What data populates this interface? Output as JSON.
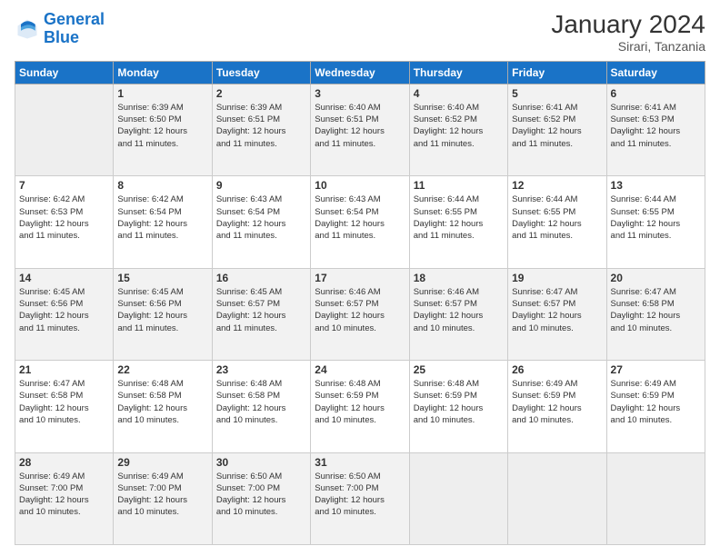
{
  "logo": {
    "line1": "General",
    "line2": "Blue"
  },
  "title": "January 2024",
  "location": "Sirari, Tanzania",
  "days_header": [
    "Sunday",
    "Monday",
    "Tuesday",
    "Wednesday",
    "Thursday",
    "Friday",
    "Saturday"
  ],
  "weeks": [
    [
      {
        "day": "",
        "info": ""
      },
      {
        "day": "1",
        "info": "Sunrise: 6:39 AM\nSunset: 6:50 PM\nDaylight: 12 hours\nand 11 minutes."
      },
      {
        "day": "2",
        "info": "Sunrise: 6:39 AM\nSunset: 6:51 PM\nDaylight: 12 hours\nand 11 minutes."
      },
      {
        "day": "3",
        "info": "Sunrise: 6:40 AM\nSunset: 6:51 PM\nDaylight: 12 hours\nand 11 minutes."
      },
      {
        "day": "4",
        "info": "Sunrise: 6:40 AM\nSunset: 6:52 PM\nDaylight: 12 hours\nand 11 minutes."
      },
      {
        "day": "5",
        "info": "Sunrise: 6:41 AM\nSunset: 6:52 PM\nDaylight: 12 hours\nand 11 minutes."
      },
      {
        "day": "6",
        "info": "Sunrise: 6:41 AM\nSunset: 6:53 PM\nDaylight: 12 hours\nand 11 minutes."
      }
    ],
    [
      {
        "day": "7",
        "info": "Sunrise: 6:42 AM\nSunset: 6:53 PM\nDaylight: 12 hours\nand 11 minutes."
      },
      {
        "day": "8",
        "info": "Sunrise: 6:42 AM\nSunset: 6:54 PM\nDaylight: 12 hours\nand 11 minutes."
      },
      {
        "day": "9",
        "info": "Sunrise: 6:43 AM\nSunset: 6:54 PM\nDaylight: 12 hours\nand 11 minutes."
      },
      {
        "day": "10",
        "info": "Sunrise: 6:43 AM\nSunset: 6:54 PM\nDaylight: 12 hours\nand 11 minutes."
      },
      {
        "day": "11",
        "info": "Sunrise: 6:44 AM\nSunset: 6:55 PM\nDaylight: 12 hours\nand 11 minutes."
      },
      {
        "day": "12",
        "info": "Sunrise: 6:44 AM\nSunset: 6:55 PM\nDaylight: 12 hours\nand 11 minutes."
      },
      {
        "day": "13",
        "info": "Sunrise: 6:44 AM\nSunset: 6:55 PM\nDaylight: 12 hours\nand 11 minutes."
      }
    ],
    [
      {
        "day": "14",
        "info": "Sunrise: 6:45 AM\nSunset: 6:56 PM\nDaylight: 12 hours\nand 11 minutes."
      },
      {
        "day": "15",
        "info": "Sunrise: 6:45 AM\nSunset: 6:56 PM\nDaylight: 12 hours\nand 11 minutes."
      },
      {
        "day": "16",
        "info": "Sunrise: 6:45 AM\nSunset: 6:57 PM\nDaylight: 12 hours\nand 11 minutes."
      },
      {
        "day": "17",
        "info": "Sunrise: 6:46 AM\nSunset: 6:57 PM\nDaylight: 12 hours\nand 10 minutes."
      },
      {
        "day": "18",
        "info": "Sunrise: 6:46 AM\nSunset: 6:57 PM\nDaylight: 12 hours\nand 10 minutes."
      },
      {
        "day": "19",
        "info": "Sunrise: 6:47 AM\nSunset: 6:57 PM\nDaylight: 12 hours\nand 10 minutes."
      },
      {
        "day": "20",
        "info": "Sunrise: 6:47 AM\nSunset: 6:58 PM\nDaylight: 12 hours\nand 10 minutes."
      }
    ],
    [
      {
        "day": "21",
        "info": "Sunrise: 6:47 AM\nSunset: 6:58 PM\nDaylight: 12 hours\nand 10 minutes."
      },
      {
        "day": "22",
        "info": "Sunrise: 6:48 AM\nSunset: 6:58 PM\nDaylight: 12 hours\nand 10 minutes."
      },
      {
        "day": "23",
        "info": "Sunrise: 6:48 AM\nSunset: 6:58 PM\nDaylight: 12 hours\nand 10 minutes."
      },
      {
        "day": "24",
        "info": "Sunrise: 6:48 AM\nSunset: 6:59 PM\nDaylight: 12 hours\nand 10 minutes."
      },
      {
        "day": "25",
        "info": "Sunrise: 6:48 AM\nSunset: 6:59 PM\nDaylight: 12 hours\nand 10 minutes."
      },
      {
        "day": "26",
        "info": "Sunrise: 6:49 AM\nSunset: 6:59 PM\nDaylight: 12 hours\nand 10 minutes."
      },
      {
        "day": "27",
        "info": "Sunrise: 6:49 AM\nSunset: 6:59 PM\nDaylight: 12 hours\nand 10 minutes."
      }
    ],
    [
      {
        "day": "28",
        "info": "Sunrise: 6:49 AM\nSunset: 7:00 PM\nDaylight: 12 hours\nand 10 minutes."
      },
      {
        "day": "29",
        "info": "Sunrise: 6:49 AM\nSunset: 7:00 PM\nDaylight: 12 hours\nand 10 minutes."
      },
      {
        "day": "30",
        "info": "Sunrise: 6:50 AM\nSunset: 7:00 PM\nDaylight: 12 hours\nand 10 minutes."
      },
      {
        "day": "31",
        "info": "Sunrise: 6:50 AM\nSunset: 7:00 PM\nDaylight: 12 hours\nand 10 minutes."
      },
      {
        "day": "",
        "info": ""
      },
      {
        "day": "",
        "info": ""
      },
      {
        "day": "",
        "info": ""
      }
    ]
  ]
}
